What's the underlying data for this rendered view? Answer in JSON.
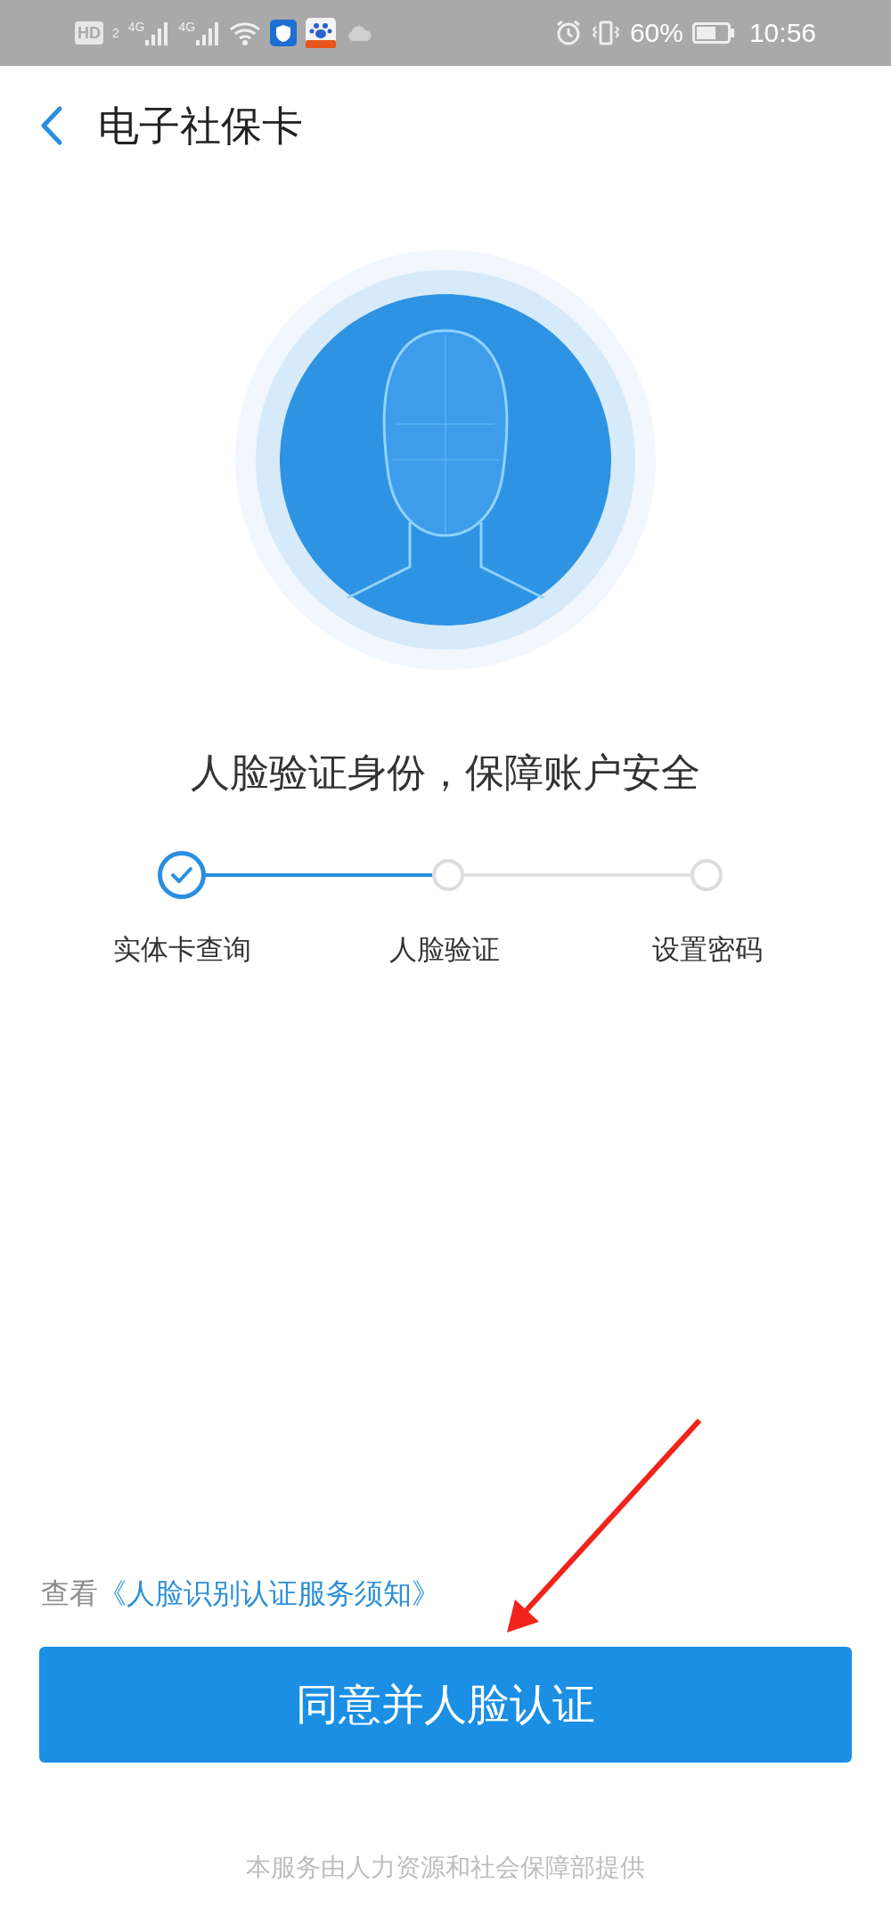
{
  "status_bar": {
    "hd": "HD",
    "sim": "2",
    "networks": [
      "4G",
      "4G"
    ],
    "battery": "60%",
    "time": "10:56"
  },
  "header": {
    "title": "电子社保卡"
  },
  "heading": "人脸验证身份，保障账户安全",
  "steps": [
    {
      "label": "实体卡查询",
      "done": true
    },
    {
      "label": "人脸验证",
      "done": false
    },
    {
      "label": "设置密码",
      "done": false
    }
  ],
  "notice": {
    "prefix": "查看",
    "link": "《人脸识别认证服务须知》"
  },
  "button": "同意并人脸认证",
  "footer": "本服务由人力资源和社会保障部提供"
}
